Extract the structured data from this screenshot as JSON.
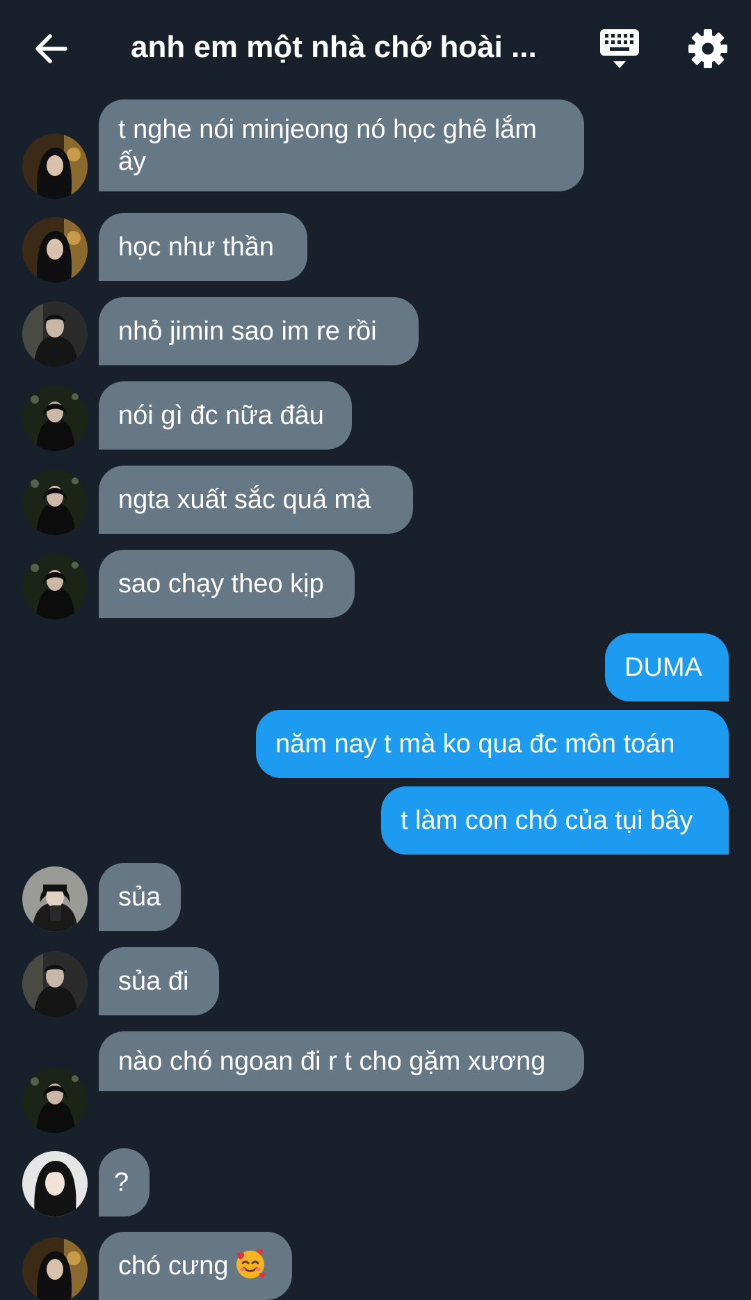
{
  "header": {
    "title": "anh em một nhà chớ hoài ...",
    "back_icon": "arrow-left-icon",
    "keyboard_icon": "keyboard-icon",
    "settings_icon": "gear-icon"
  },
  "colors": {
    "background": "#17202b",
    "incoming_bubble": "#667785",
    "outgoing_bubble": "#1d9bf0"
  },
  "messages": [
    {
      "direction": "incoming",
      "text": "t nghe nói minjeong nó học ghê lắm ấy"
    },
    {
      "direction": "incoming",
      "text": "học như thần"
    },
    {
      "direction": "incoming",
      "text": "nhỏ jimin sao im re rồi"
    },
    {
      "direction": "incoming",
      "text": "nói gì đc nữa đâu"
    },
    {
      "direction": "incoming",
      "text": "ngta xuất sắc quá mà"
    },
    {
      "direction": "incoming",
      "text": "sao chạy theo kịp"
    },
    {
      "direction": "outgoing",
      "text": "DUMA"
    },
    {
      "direction": "outgoing",
      "text": "năm nay t mà ko qua đc môn toán"
    },
    {
      "direction": "outgoing",
      "text": "t làm con chó của tụi bây"
    },
    {
      "direction": "incoming",
      "text": "sủa"
    },
    {
      "direction": "incoming",
      "text": "sủa đi"
    },
    {
      "direction": "incoming",
      "text": "nào chó ngoan đi r t cho gặm xương"
    },
    {
      "direction": "incoming",
      "text": "?"
    },
    {
      "direction": "incoming",
      "text": "chó cưng",
      "emoji": "smiling-face-with-hearts-icon"
    }
  ]
}
